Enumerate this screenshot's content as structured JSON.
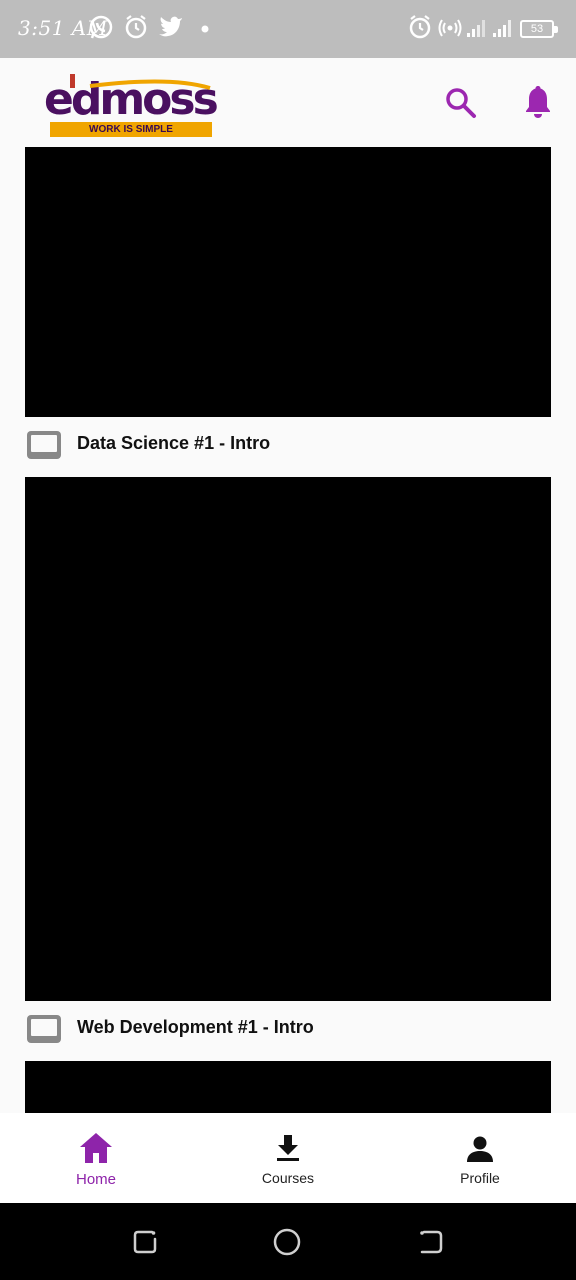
{
  "status_bar": {
    "time": "3:51 AM",
    "icons": [
      "whatsapp-icon",
      "alarm-icon",
      "twitter-icon",
      "dot-icon",
      "alarm-icon",
      "hotspot-icon",
      "signal-icon",
      "signal-icon",
      "battery-icon"
    ],
    "battery": "53"
  },
  "header": {
    "logo_text": "edmoss",
    "logo_tagline": "WORK IS SIMPLE",
    "accent_color": "#9c27b0"
  },
  "videos": [
    {
      "title": "Data Science #1 - Intro"
    },
    {
      "title": "Web Development #1 - Intro"
    }
  ],
  "bottom_nav": {
    "items": [
      {
        "label": "Home",
        "icon": "home-icon",
        "active": true
      },
      {
        "label": "Courses",
        "icon": "download-icon",
        "active": false
      },
      {
        "label": "Profile",
        "icon": "person-icon",
        "active": false
      }
    ]
  },
  "system_nav": [
    "recents-icon",
    "home-circle-icon",
    "back-icon"
  ]
}
